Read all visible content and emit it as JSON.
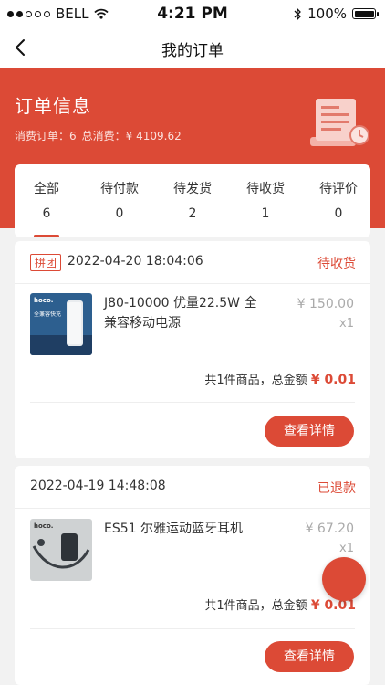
{
  "status_bar": {
    "carrier": "BELL",
    "time": "4:21 PM",
    "battery": "100%"
  },
  "nav": {
    "title": "我的订单",
    "back_icon": "chevron-left-icon"
  },
  "summary": {
    "title": "订单信息",
    "orders_label": "消费订单：",
    "orders_count": "6",
    "total_label": "总消费：",
    "total_value": "¥ 4109.62"
  },
  "tabs": [
    {
      "label": "全部",
      "count": "6",
      "active": true
    },
    {
      "label": "待付款",
      "count": "0"
    },
    {
      "label": "待发货",
      "count": "2"
    },
    {
      "label": "待收货",
      "count": "1"
    },
    {
      "label": "待评价",
      "count": "0"
    }
  ],
  "orders": [
    {
      "badge": "拼团",
      "date": "2022-04-20 18:04:06",
      "status": "待收货",
      "product_name": "J80-10000 优量22.5W 全兼容移动电源",
      "price": "¥ 150.00",
      "qty": "x1",
      "summary_text": "共1件商品，总金额",
      "total": "¥ 0.01",
      "button": "查看详情",
      "thumb_brand": "hoco.",
      "thumb_caption": "全兼容快充"
    },
    {
      "date": "2022-04-19 14:48:08",
      "status": "已退款",
      "product_name": "ES51 尔雅运动蓝牙耳机",
      "price": "¥ 67.20",
      "qty": "x1",
      "summary_text": "共1件商品，总金额",
      "total": "¥ 0.01",
      "button": "查看详情",
      "thumb_brand": "hoco."
    }
  ],
  "colors": {
    "accent": "#dc4a36",
    "background": "#f2f2f2"
  }
}
